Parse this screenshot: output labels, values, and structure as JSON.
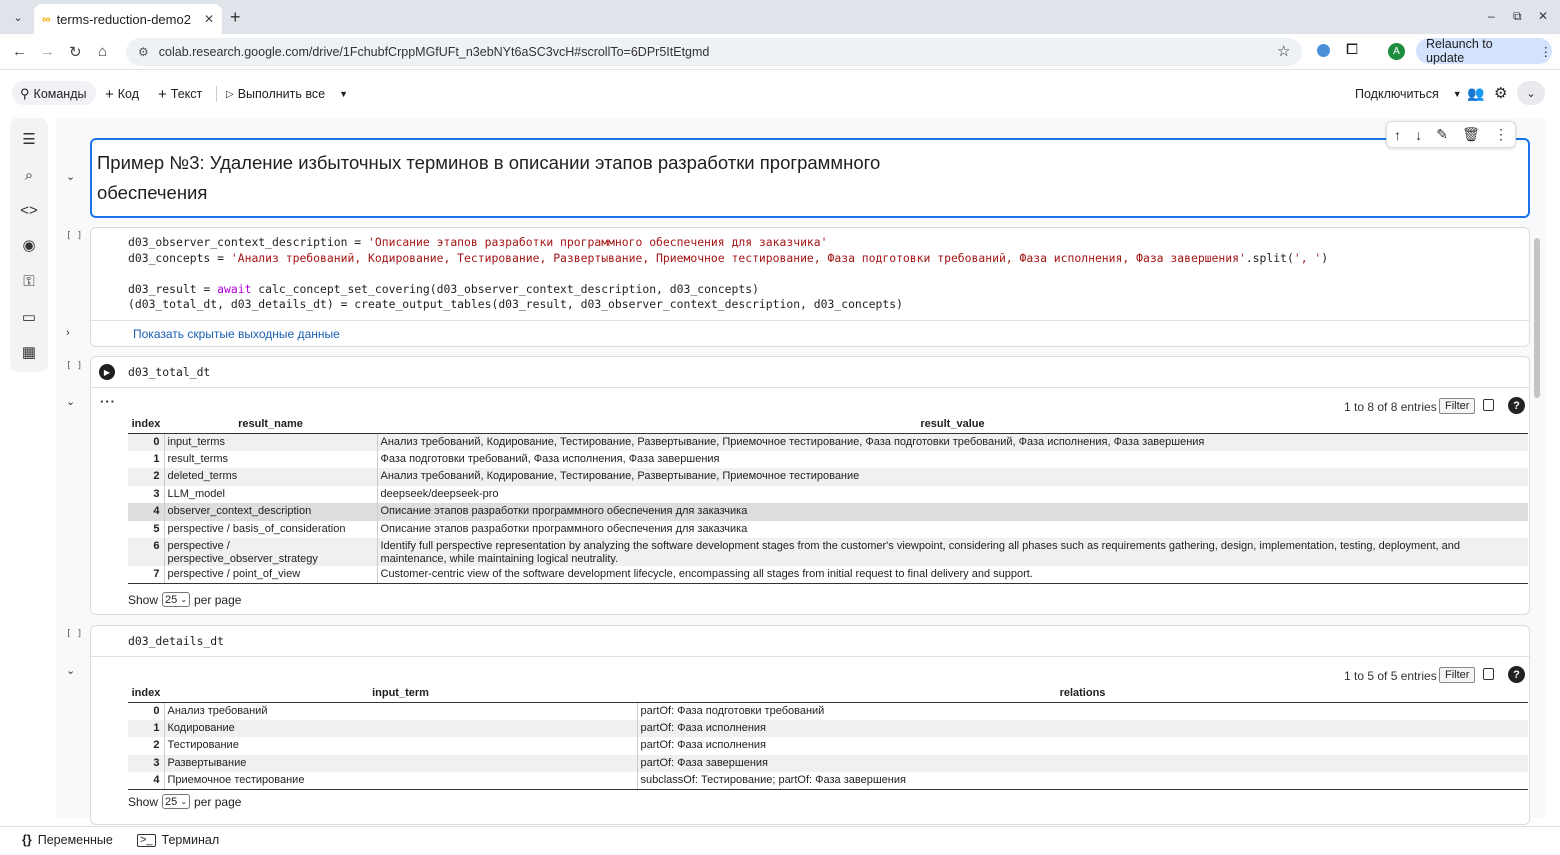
{
  "browser": {
    "tab_title": "terms-reduction-demo2",
    "url": "colab.research.google.com/drive/1FchubfCrppMGfUFt_n3ebNYt6aSC3vcH#scrollTo=6DPr5ItEtgmd",
    "relaunch_label": "Relaunch to update",
    "avatar_letter": "A"
  },
  "toolbar": {
    "commands": "Команды",
    "code": "Код",
    "text": "Текст",
    "run_all": "Выполнить все",
    "connect": "Подключиться"
  },
  "cells": {
    "md_title_line1": "Пример №3: Удаление избыточных терминов в описании этапов разработки программного",
    "md_title_line2": "обеспечения",
    "show_hidden": "Показать скрытые выходные данные",
    "code2": "d03_total_dt",
    "code3": "d03_details_dt"
  },
  "table1": {
    "entries": "1 to 8 of 8 entries",
    "filter": "Filter",
    "headers": [
      "index",
      "result_name",
      "result_value"
    ],
    "rows": [
      [
        "0",
        "input_terms",
        "Анализ требований, Кодирование, Тестирование, Развертывание, Приемочное тестирование, Фаза подготовки требований, Фаза исполнения, Фаза завершения"
      ],
      [
        "1",
        "result_terms",
        "Фаза подготовки требований, Фаза исполнения, Фаза завершения"
      ],
      [
        "2",
        "deleted_terms",
        "Анализ требований, Кодирование, Тестирование, Развертывание, Приемочное тестирование"
      ],
      [
        "3",
        "LLM_model",
        "deepseek/deepseek-pro"
      ],
      [
        "4",
        "observer_context_description",
        "Описание этапов разработки программного обеспечения для заказчика"
      ],
      [
        "5",
        "perspective / basis_of_consideration",
        "Описание этапов разработки программного обеспечения для заказчика"
      ],
      [
        "6",
        "perspective / perspective_observer_strategy",
        "Identify full perspective representation by analyzing the software development stages from the customer's viewpoint, considering all phases such as requirements gathering, design, implementation, testing, deployment, and maintenance, while maintaining logical neutrality."
      ],
      [
        "7",
        "perspective / point_of_view",
        "Customer-centric view of the software development lifecycle, encompassing all stages from initial request to final delivery and support."
      ]
    ],
    "show": "Show",
    "per_page_value": "25",
    "per_page": "per page"
  },
  "table2": {
    "entries": "1 to 5 of 5 entries",
    "filter": "Filter",
    "headers": [
      "index",
      "input_term",
      "relations"
    ],
    "rows": [
      [
        "0",
        "Анализ требований",
        "partOf: Фаза подготовки требований"
      ],
      [
        "1",
        "Кодирование",
        "partOf: Фаза исполнения"
      ],
      [
        "2",
        "Тестирование",
        "partOf: Фаза исполнения"
      ],
      [
        "3",
        "Развертывание",
        "partOf: Фаза завершения"
      ],
      [
        "4",
        "Приемочное тестирование",
        "subclassOf: Тестирование; partOf: Фаза завершения"
      ]
    ],
    "show": "Show",
    "per_page_value": "25",
    "per_page": "per page"
  },
  "bottom": {
    "variables": "Переменные",
    "terminal": "Терминал"
  },
  "colors": {
    "accent": "#1a73e8",
    "string": "#a31515",
    "keyword": "#af00db"
  }
}
